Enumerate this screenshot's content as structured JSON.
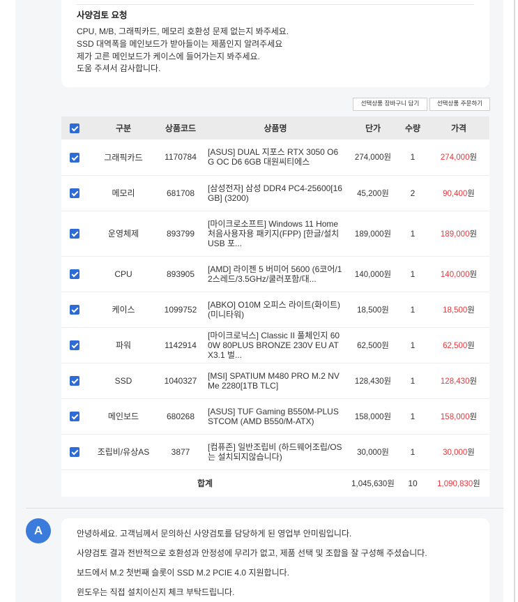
{
  "request": {
    "title": "사양검토 요청",
    "lines": [
      "CPU, M/B, 그래픽카드, 메모리 호환성 문제 없는지 봐주세요.",
      "SSD 대역폭을 메인보드가 받아들이는 제품인지 알려주세요",
      "제가 고른 메인보드가 케이스에 들어가는지 봐주세요.",
      "도움 주셔서 감사합니다."
    ]
  },
  "actions": {
    "add_to_cart_label": "선택상품 장바구니 담기",
    "order_label": "선택상품 주문하기"
  },
  "table": {
    "select_all_checked": true,
    "headers": {
      "category": "구분",
      "code": "상품코드",
      "name": "상품명",
      "unit_price": "단가",
      "qty": "수량",
      "price": "가격"
    },
    "rows": [
      {
        "checked": true,
        "category": "그래픽카드",
        "code": "1170784",
        "name": "[ASUS] DUAL 지포스 RTX 3050 O6G OC D6 6GB 대원씨티에스",
        "unit_price": "274,000원",
        "qty": "1",
        "price": "274,000",
        "price_unit": "원"
      },
      {
        "checked": true,
        "category": "메모리",
        "code": "681708",
        "name": "[삼성전자] 삼성 DDR4 PC4-25600[16GB] (3200)",
        "unit_price": "45,200원",
        "qty": "2",
        "price": "90,400",
        "price_unit": "원"
      },
      {
        "checked": true,
        "category": "운영체제",
        "code": "893799",
        "name": "[마이크로소프트] Windows 11 Home 처음사용자용 패키지(FPP) [한글/설치USB 포...",
        "unit_price": "189,000원",
        "qty": "1",
        "price": "189,000",
        "price_unit": "원"
      },
      {
        "checked": true,
        "category": "CPU",
        "code": "893905",
        "name": "[AMD] 라이젠 5 버미어 5600 (6코어/12스레드/3.5GHz/쿨러포함/대...",
        "unit_price": "140,000원",
        "qty": "1",
        "price": "140,000",
        "price_unit": "원"
      },
      {
        "checked": true,
        "category": "케이스",
        "code": "1099752",
        "name": "[ABKO] O10M 오피스 라이트(화이트) (미니타워)",
        "unit_price": "18,500원",
        "qty": "1",
        "price": "18,500",
        "price_unit": "원"
      },
      {
        "checked": true,
        "category": "파워",
        "code": "1142914",
        "name": "[마이크로닉스] Classic II 풀체인지 600W 80PLUS BRONZE 230V EU ATX3.1 벌...",
        "unit_price": "62,500원",
        "qty": "1",
        "price": "62,500",
        "price_unit": "원"
      },
      {
        "checked": true,
        "category": "SSD",
        "code": "1040327",
        "name": "[MSI] SPATIUM M480 PRO M.2 NVMe 2280[1TB TLC]",
        "unit_price": "128,430원",
        "qty": "1",
        "price": "128,430",
        "price_unit": "원"
      },
      {
        "checked": true,
        "category": "메인보드",
        "code": "680268",
        "name": "[ASUS] TUF Gaming B550M-PLUS STCOM (AMD B550/M-ATX)",
        "unit_price": "158,000원",
        "qty": "1",
        "price": "158,000",
        "price_unit": "원"
      },
      {
        "checked": true,
        "category": "조립비/유상AS",
        "code": "3877",
        "name": "[컴퓨존] 일반조립비 (하드웨어조립/OS는 설치되지않습니다)",
        "unit_price": "30,000원",
        "qty": "1",
        "price": "30,000",
        "price_unit": "원"
      }
    ],
    "total": {
      "label": "합계",
      "unit_price": "1,045,630원",
      "qty": "10",
      "price": "1,090,830",
      "price_unit": "원"
    }
  },
  "answer": {
    "badge": "A",
    "lines": [
      "안녕하세요. 고객님께서 문의하신 사양검토를 담당하게 된 영업부 안미림입니다.",
      "사양검토 결과 전반적으로 호환성과 안정성에 무리가 없고, 제품 선택 및 조합을 잘 구성해 주셨습니다.",
      "보드에서 M.2 첫번째 슬롯이 SSD M.2 PCIE 4.0 지원합니다.",
      "윈도우는 직접 설치이신지 체크 부탁드립니다."
    ]
  },
  "colors": {
    "accent": "#2e6bd6",
    "price_red": "#e8383d",
    "badge": "#3b7bdb",
    "panel_bg": "#f5f6f8",
    "header_bg": "#ebebeb"
  }
}
